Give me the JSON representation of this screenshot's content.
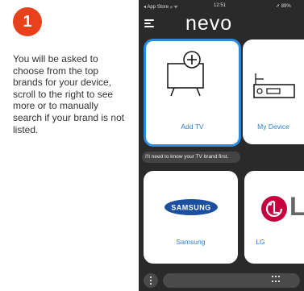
{
  "step": {
    "number": "1"
  },
  "instructions": "You will be asked to choose from the top brands for your device, scroll to the right to see more or to manually search if your brand is not listed.",
  "status_bar": {
    "left": "◂ App Store ᵢₗₗ ᯤ",
    "time": "12:51",
    "right": "➚ 89%"
  },
  "app": {
    "title": "nevo"
  },
  "tiles": {
    "add_tv": {
      "label": "Add TV"
    },
    "my_device": {
      "label": "My Device"
    },
    "samsung": {
      "label": "Samsung",
      "logo_text": "SAMSUNG"
    },
    "lg": {
      "label": "LG",
      "logo_text": "L"
    }
  },
  "hint": "I'll need to know your TV brand first.",
  "colors": {
    "accent": "#2b8be0",
    "step_badge": "#e8421c",
    "phone_bg": "#2a2a2a",
    "samsung": "#1d4fa0",
    "lg": "#c6003d"
  }
}
